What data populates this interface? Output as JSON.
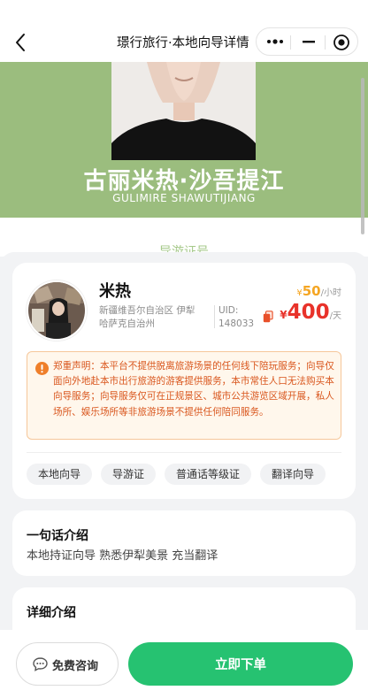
{
  "nav": {
    "title": "璟行旅行·本地向导详情",
    "back_icon": "back-arrow-icon",
    "more_icon": "more-dots-icon",
    "minimize_icon": "minimize-icon",
    "record_icon": "record-icon"
  },
  "banner": {
    "name_cn": "古丽米热·沙吾提江",
    "name_en": "GULIMIRE SHAWUTIJIANG",
    "bg_color": "#9bbd7e"
  },
  "section_peek": "导游证号",
  "guide": {
    "nickname": "米热",
    "region": "新疆维吾尔自治区 伊犁哈萨克自治州",
    "uid_label": "UID:",
    "uid_value": "148033",
    "price_hour": {
      "currency": "¥",
      "value": "50",
      "unit": "/小时"
    },
    "price_day": {
      "currency": "¥",
      "value": "400",
      "unit": "/天"
    }
  },
  "notice": {
    "icon": "warning-icon",
    "text": "郑重声明：本平台不提供脱离旅游场景的任何线下陪玩服务；向导仅面向外地赴本市出行旅游的游客提供服务，本市常住人口无法购买本向导服务；向导服务仅可在正规景区、城市公共游览区域开展，私人场所、娱乐场所等非旅游场景不提供任何陪同服务。"
  },
  "tags": [
    "本地向导",
    "导游证",
    "普通话等级证",
    "翻译向导"
  ],
  "intro": {
    "title": "一句话介绍",
    "body": "本地持证向导 熟悉伊犁美景 充当翻译"
  },
  "detail": {
    "title": "详细介绍"
  },
  "bottom": {
    "consult_label": "免费咨询",
    "consult_icon": "chat-bubble-icon",
    "order_label": "立即下单",
    "accent": "#26c271"
  }
}
